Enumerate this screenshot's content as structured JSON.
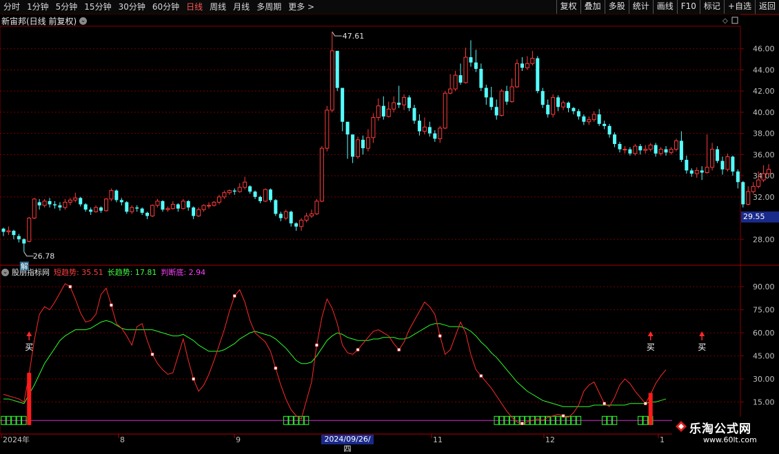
{
  "toolbar": {
    "periods": [
      {
        "label": "分时"
      },
      {
        "label": "1分钟"
      },
      {
        "label": "5分钟"
      },
      {
        "label": "15分钟"
      },
      {
        "label": "30分钟"
      },
      {
        "label": "60分钟"
      },
      {
        "label": "日线",
        "active": true
      },
      {
        "label": "周线"
      },
      {
        "label": "月线"
      },
      {
        "label": "多周期"
      },
      {
        "label": "更多 >"
      }
    ],
    "buttons": [
      "复权",
      "叠加",
      "多股",
      "统计",
      "画线",
      "F10",
      "标记",
      "+自选",
      "返回"
    ]
  },
  "main_chart": {
    "stock_title": "新宙邦(日线 前复权)",
    "high_label": "47.61",
    "low_label": "26.78",
    "low_tag": "解",
    "current_price": "29.55",
    "y_ticks": [
      "46.00",
      "44.00",
      "42.00",
      "40.00",
      "38.00",
      "36.00",
      "34.00",
      "32.00",
      "28.00"
    ]
  },
  "indicator": {
    "name": "股朋指标网",
    "short_label": "短趋势: ",
    "short_value": "35.51",
    "long_label": "长趋势: ",
    "long_value": "17.81",
    "judge_label": "判断底: ",
    "judge_value": "2.94",
    "y_ticks": [
      "90.00",
      "75.00",
      "60.00",
      "45.00",
      "30.00",
      "15.00"
    ],
    "buy_label": "买"
  },
  "x_axis": {
    "labels": [
      "2024年",
      "8",
      "9",
      "11",
      "12",
      "1"
    ],
    "cursor_date": "2024/09/26/四"
  },
  "watermark": {
    "title": "乐淘公式网",
    "url": "www.60lt.com"
  },
  "colors": {
    "up": "#ff3b3b",
    "down": "#54ffff",
    "short_line": "#ff2a2a",
    "long_line": "#2aff2a",
    "judge_line": "#c020c0",
    "grid": "#7a0000"
  },
  "chart_data": {
    "type": "candlestick",
    "price_ylim": [
      26,
      48
    ],
    "indicator_ylim": [
      0,
      95
    ],
    "candles": [
      [
        29.0,
        28.7,
        29.1,
        28.3
      ],
      [
        28.7,
        28.8,
        29.2,
        28.4
      ],
      [
        28.8,
        28.4,
        28.9,
        28.0
      ],
      [
        28.3,
        28.0,
        28.5,
        27.7
      ],
      [
        28.0,
        27.6,
        28.1,
        26.8
      ],
      [
        27.8,
        30.0,
        30.1,
        27.7
      ],
      [
        30.0,
        31.8,
        31.9,
        29.9
      ],
      [
        31.5,
        31.2,
        31.8,
        30.8
      ],
      [
        31.2,
        31.6,
        31.8,
        31.0
      ],
      [
        31.6,
        31.3,
        31.9,
        31.0
      ],
      [
        31.3,
        31.2,
        31.6,
        30.9
      ],
      [
        31.2,
        31.0,
        31.5,
        30.7
      ],
      [
        31.0,
        31.5,
        31.8,
        30.8
      ],
      [
        31.5,
        31.7,
        31.9,
        31.2
      ],
      [
        31.7,
        31.9,
        32.4,
        31.5
      ],
      [
        31.9,
        31.3,
        32.0,
        31.1
      ],
      [
        31.3,
        30.8,
        31.4,
        30.6
      ],
      [
        30.8,
        30.6,
        31.0,
        30.3
      ],
      [
        30.6,
        31.0,
        31.2,
        30.5
      ],
      [
        31.0,
        30.7,
        31.1,
        30.5
      ],
      [
        30.7,
        31.8,
        31.9,
        30.6
      ],
      [
        31.8,
        32.6,
        32.8,
        31.6
      ],
      [
        32.6,
        31.7,
        32.7,
        31.5
      ],
      [
        31.7,
        31.5,
        31.9,
        31.2
      ],
      [
        31.5,
        30.6,
        31.6,
        30.4
      ],
      [
        30.6,
        31.0,
        31.2,
        30.4
      ],
      [
        31.0,
        30.9,
        31.2,
        30.6
      ],
      [
        30.9,
        30.5,
        31.0,
        30.3
      ],
      [
        30.5,
        30.2,
        30.6,
        29.9
      ],
      [
        30.2,
        31.2,
        31.3,
        30.1
      ],
      [
        31.2,
        31.6,
        31.8,
        31.0
      ],
      [
        31.6,
        30.8,
        31.7,
        30.6
      ],
      [
        30.8,
        30.9,
        31.1,
        30.6
      ],
      [
        30.9,
        31.3,
        31.6,
        30.8
      ],
      [
        31.3,
        30.9,
        31.4,
        30.6
      ],
      [
        30.9,
        31.6,
        31.8,
        30.8
      ],
      [
        31.6,
        31.0,
        31.7,
        30.7
      ],
      [
        31.0,
        30.2,
        31.1,
        29.9
      ],
      [
        30.2,
        30.8,
        31.0,
        30.1
      ],
      [
        30.8,
        31.2,
        31.3,
        30.6
      ],
      [
        31.2,
        31.2,
        31.5,
        30.9
      ],
      [
        31.2,
        31.5,
        31.6,
        31.1
      ],
      [
        31.5,
        32.0,
        32.2,
        31.3
      ],
      [
        32.0,
        32.4,
        32.6,
        31.8
      ],
      [
        32.4,
        32.6,
        32.7,
        32.2
      ],
      [
        32.6,
        32.5,
        32.8,
        32.2
      ],
      [
        32.5,
        32.9,
        33.3,
        32.4
      ],
      [
        32.9,
        33.4,
        33.9,
        32.7
      ],
      [
        33.0,
        32.5,
        33.1,
        32.3
      ],
      [
        32.5,
        32.0,
        32.6,
        31.8
      ],
      [
        32.0,
        31.6,
        32.1,
        31.4
      ],
      [
        31.6,
        32.7,
        32.8,
        31.5
      ],
      [
        32.7,
        31.7,
        32.8,
        31.5
      ],
      [
        31.7,
        30.4,
        31.8,
        30.2
      ],
      [
        30.4,
        30.0,
        30.6,
        29.7
      ],
      [
        30.0,
        30.6,
        30.8,
        29.8
      ],
      [
        30.6,
        29.5,
        30.7,
        29.2
      ],
      [
        29.5,
        29.2,
        29.6,
        28.8
      ],
      [
        29.2,
        29.8,
        30.0,
        28.8
      ],
      [
        29.8,
        30.2,
        30.5,
        29.6
      ],
      [
        30.2,
        30.4,
        30.8,
        30.0
      ],
      [
        30.4,
        31.6,
        31.8,
        30.3
      ],
      [
        31.6,
        36.6,
        36.8,
        31.5
      ],
      [
        36.6,
        40.2,
        40.6,
        36.3
      ],
      [
        40.2,
        45.8,
        47.6,
        40.0
      ],
      [
        45.8,
        42.3,
        44.2,
        42.0
      ],
      [
        42.3,
        39.1,
        41.6,
        38.2
      ],
      [
        39.1,
        37.9,
        38.4,
        35.6
      ],
      [
        37.9,
        35.8,
        37.8,
        35.2
      ],
      [
        35.8,
        37.4,
        37.7,
        35.6
      ],
      [
        37.4,
        36.6,
        37.8,
        36.0
      ],
      [
        36.6,
        37.6,
        38.4,
        36.3
      ],
      [
        37.6,
        39.5,
        39.9,
        37.1
      ],
      [
        39.5,
        40.6,
        41.3,
        39.2
      ],
      [
        40.6,
        39.6,
        41.5,
        39.3
      ],
      [
        39.6,
        40.3,
        41.0,
        39.5
      ],
      [
        40.3,
        40.9,
        41.5,
        40.0
      ],
      [
        40.9,
        40.7,
        42.5,
        40.4
      ],
      [
        40.7,
        41.4,
        41.7,
        40.2
      ],
      [
        41.4,
        40.4,
        41.6,
        40.1
      ],
      [
        40.4,
        39.2,
        40.7,
        38.9
      ],
      [
        39.2,
        38.2,
        39.8,
        37.8
      ],
      [
        38.2,
        38.6,
        39.5,
        37.9
      ],
      [
        38.6,
        38.0,
        39.1,
        37.7
      ],
      [
        38.0,
        37.5,
        38.3,
        37.2
      ],
      [
        37.5,
        38.5,
        38.7,
        37.1
      ],
      [
        38.5,
        41.8,
        42.0,
        38.4
      ],
      [
        41.8,
        42.2,
        43.6,
        41.7
      ],
      [
        42.2,
        43.5,
        43.9,
        42.0
      ],
      [
        43.5,
        42.8,
        44.6,
        42.6
      ],
      [
        42.8,
        45.2,
        46.1,
        42.7
      ],
      [
        45.2,
        44.7,
        46.8,
        44.3
      ],
      [
        44.7,
        44.1,
        45.9,
        43.8
      ],
      [
        44.1,
        42.3,
        44.6,
        42.0
      ],
      [
        42.3,
        41.4,
        42.6,
        40.7
      ],
      [
        41.4,
        40.5,
        42.4,
        40.2
      ],
      [
        40.5,
        39.7,
        41.2,
        39.3
      ],
      [
        39.7,
        42.0,
        42.2,
        39.6
      ],
      [
        42.0,
        41.0,
        42.5,
        40.7
      ],
      [
        41.0,
        42.4,
        43.2,
        40.9
      ],
      [
        42.4,
        44.6,
        45.0,
        42.3
      ],
      [
        44.6,
        44.2,
        45.2,
        43.9
      ],
      [
        44.2,
        44.6,
        45.3,
        44.0
      ],
      [
        44.6,
        45.1,
        45.8,
        44.4
      ],
      [
        45.1,
        42.0,
        45.3,
        41.8
      ],
      [
        42.0,
        40.7,
        42.3,
        40.4
      ],
      [
        40.7,
        39.8,
        41.2,
        39.5
      ],
      [
        39.8,
        41.4,
        41.7,
        39.5
      ],
      [
        41.4,
        40.5,
        41.6,
        40.1
      ],
      [
        40.5,
        40.9,
        41.1,
        40.2
      ],
      [
        40.9,
        40.4,
        41.0,
        40.0
      ],
      [
        40.4,
        40.1,
        40.5,
        39.8
      ],
      [
        40.1,
        39.6,
        40.3,
        39.3
      ],
      [
        39.6,
        39.1,
        39.8,
        38.8
      ],
      [
        39.1,
        39.3,
        39.6,
        38.8
      ],
      [
        39.3,
        39.8,
        40.1,
        39.1
      ],
      [
        39.8,
        38.9,
        40.3,
        38.7
      ],
      [
        38.9,
        38.7,
        39.2,
        38.4
      ],
      [
        38.7,
        37.9,
        38.9,
        37.6
      ],
      [
        37.9,
        37.0,
        38.1,
        36.7
      ],
      [
        37.0,
        36.5,
        37.2,
        36.2
      ],
      [
        36.5,
        36.5,
        36.8,
        36.1
      ],
      [
        36.5,
        36.1,
        36.7,
        35.9
      ],
      [
        36.1,
        36.8,
        37.0,
        35.9
      ],
      [
        36.8,
        36.4,
        37.0,
        36.0
      ],
      [
        36.4,
        36.5,
        36.9,
        36.1
      ],
      [
        36.5,
        36.9,
        37.1,
        36.3
      ],
      [
        36.9,
        36.1,
        37.1,
        35.8
      ],
      [
        36.1,
        36.5,
        36.7,
        35.9
      ],
      [
        36.5,
        36.2,
        36.8,
        35.9
      ],
      [
        36.2,
        36.5,
        36.7,
        36.0
      ],
      [
        36.5,
        37.3,
        37.5,
        36.3
      ],
      [
        37.3,
        35.5,
        38.2,
        35.3
      ],
      [
        35.5,
        34.5,
        35.9,
        34.2
      ],
      [
        34.5,
        34.2,
        34.7,
        33.9
      ],
      [
        34.2,
        34.5,
        34.8,
        33.8
      ],
      [
        34.5,
        34.3,
        34.9,
        33.6
      ],
      [
        34.3,
        34.8,
        37.9,
        34.2
      ],
      [
        34.8,
        36.5,
        37.1,
        34.5
      ],
      [
        36.5,
        35.4,
        36.8,
        35.2
      ],
      [
        35.4,
        34.6,
        35.8,
        34.1
      ],
      [
        34.6,
        35.8,
        36.1,
        34.4
      ],
      [
        35.8,
        34.4,
        35.9,
        34.0
      ],
      [
        34.4,
        33.4,
        34.6,
        32.8
      ],
      [
        33.4,
        31.3,
        33.5,
        31.0
      ],
      [
        31.3,
        32.5,
        33.0,
        31.2
      ],
      [
        32.5,
        33.0,
        33.4,
        32.3
      ],
      [
        33.0,
        33.6,
        34.4,
        32.8
      ],
      [
        33.6,
        34.2,
        35.0,
        33.4
      ],
      [
        34.2,
        34.6,
        35.1,
        34.0
      ]
    ],
    "short_trend": [
      20,
      19,
      18,
      17,
      15,
      33,
      55,
      72,
      77,
      75,
      80,
      86,
      92,
      90,
      82,
      73,
      67,
      68,
      72,
      85,
      89,
      78,
      66,
      63,
      58,
      52,
      64,
      66,
      55,
      46,
      40,
      36,
      33,
      34,
      45,
      56,
      42,
      30,
      22,
      26,
      33,
      42,
      52,
      62,
      74,
      84,
      88,
      80,
      68,
      60,
      57,
      54,
      48,
      37,
      26,
      17,
      10,
      6,
      4,
      16,
      28,
      52,
      70,
      82,
      76,
      66,
      52,
      47,
      46,
      49,
      53,
      57,
      61,
      62,
      60,
      58,
      53,
      49,
      54,
      62,
      68,
      74,
      80,
      77,
      72,
      58,
      46,
      49,
      58,
      67,
      60,
      46,
      36,
      32,
      28,
      24,
      19,
      14,
      9,
      5,
      2,
      1,
      2,
      3,
      4,
      3,
      5,
      6,
      7,
      6,
      5,
      8,
      13,
      22,
      26,
      28,
      21,
      14,
      12,
      18,
      26,
      30,
      27,
      22,
      18,
      14,
      20,
      27,
      32,
      36
    ],
    "long_trend": [
      17,
      17,
      16,
      15,
      14,
      20,
      26,
      33,
      40,
      45,
      50,
      55,
      58,
      60,
      62,
      62,
      62,
      63,
      65,
      67,
      68,
      67,
      65,
      63,
      62,
      62,
      62,
      62,
      62,
      62,
      61,
      60,
      59,
      58,
      58,
      59,
      57,
      55,
      52,
      50,
      48,
      48,
      48,
      49,
      51,
      53,
      56,
      58,
      60,
      61,
      60,
      59,
      58,
      56,
      53,
      50,
      46,
      42,
      40,
      40,
      41,
      45,
      50,
      55,
      58,
      60,
      59,
      57,
      56,
      55,
      55,
      55,
      56,
      56,
      57,
      57,
      57,
      56,
      56,
      57,
      59,
      61,
      63,
      65,
      66,
      66,
      65,
      64,
      64,
      64,
      63,
      61,
      58,
      54,
      51,
      47,
      44,
      40,
      36,
      32,
      28,
      25,
      22,
      20,
      18,
      16,
      15,
      14,
      13,
      12,
      12,
      12,
      12,
      12,
      12,
      13,
      13,
      13,
      13,
      13,
      13,
      13,
      14,
      14,
      14,
      14,
      15,
      15,
      16,
      17
    ],
    "judge_line": 3,
    "buy_signal_indices": [
      5,
      126,
      136
    ]
  }
}
